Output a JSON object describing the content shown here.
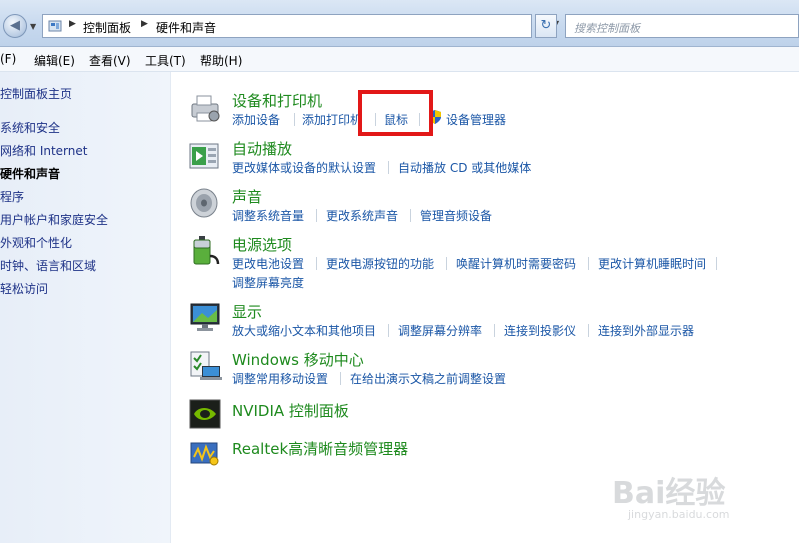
{
  "address_bar": {
    "crumbs": [
      "控制面板",
      "硬件和声音"
    ],
    "search_placeholder": "搜索控制面板"
  },
  "menu": [
    "(F)",
    "编辑(E)",
    "查看(V)",
    "工具(T)",
    "帮助(H)"
  ],
  "sidebar": {
    "items": [
      {
        "label": "控制面板主页",
        "active": false
      },
      {
        "label": "系统和安全",
        "active": false
      },
      {
        "label": "网络和 Internet",
        "active": false
      },
      {
        "label": "硬件和声音",
        "active": true
      },
      {
        "label": "程序",
        "active": false
      },
      {
        "label": "用户帐户和家庭安全",
        "active": false
      },
      {
        "label": "外观和个性化",
        "active": false
      },
      {
        "label": "时钟、语言和区域",
        "active": false
      },
      {
        "label": "轻松访问",
        "active": false
      }
    ]
  },
  "categories": [
    {
      "title": "设备和打印机",
      "icon": "printer-icon",
      "links": [
        "添加设备",
        "添加打印机",
        "鼠标",
        "设备管理器"
      ]
    },
    {
      "title": "自动播放",
      "icon": "autoplay-icon",
      "links": [
        "更改媒体或设备的默认设置",
        "自动播放 CD 或其他媒体"
      ]
    },
    {
      "title": "声音",
      "icon": "speaker-icon",
      "links": [
        "调整系统音量",
        "更改系统声音",
        "管理音频设备"
      ]
    },
    {
      "title": "电源选项",
      "icon": "battery-icon",
      "links": [
        "更改电池设置",
        "更改电源按钮的功能",
        "唤醒计算机时需要密码",
        "更改计算机睡眠时间",
        "调整屏幕亮度"
      ]
    },
    {
      "title": "显示",
      "icon": "monitor-icon",
      "links": [
        "放大或缩小文本和其他项目",
        "调整屏幕分辨率",
        "连接到投影仪",
        "连接到外部显示器"
      ]
    },
    {
      "title": "Windows 移动中心",
      "icon": "mobility-center-icon",
      "links": [
        "调整常用移动设置",
        "在给出演示文稿之前调整设置"
      ]
    },
    {
      "title": "NVIDIA 控制面板",
      "icon": "nvidia-icon",
      "links": []
    },
    {
      "title": "Realtek高清晰音频管理器",
      "icon": "realtek-audio-icon",
      "links": []
    }
  ],
  "watermark": {
    "brand": "Bai经验",
    "url": "jingyan.baidu.com"
  }
}
